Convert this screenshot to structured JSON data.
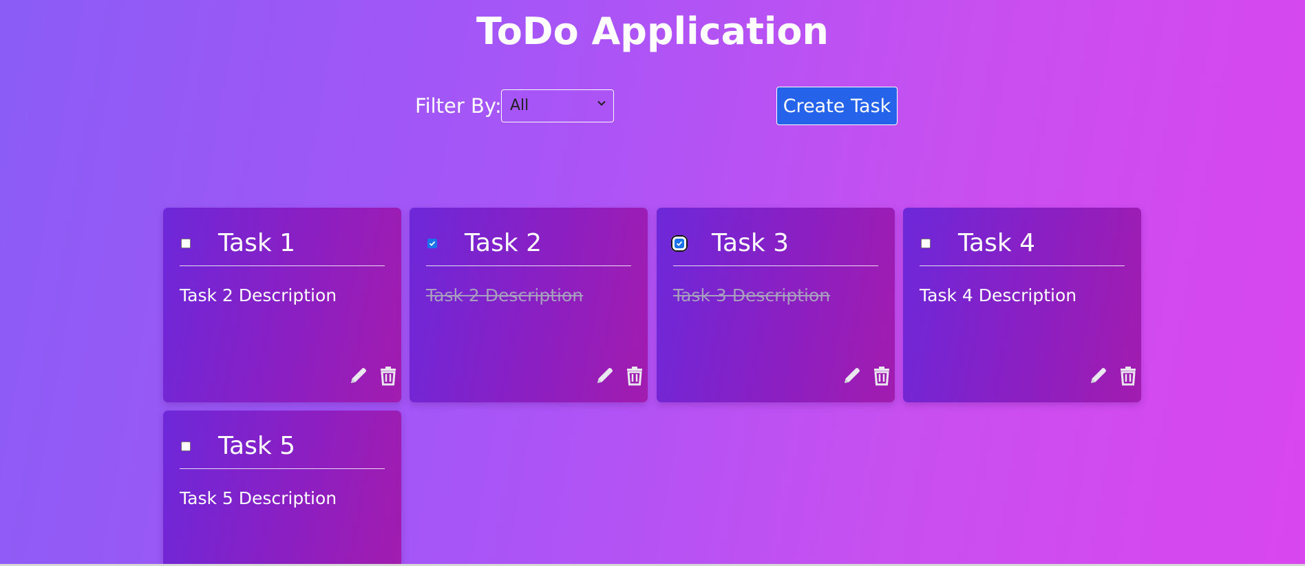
{
  "app": {
    "title": "ToDo Application"
  },
  "toolbar": {
    "filter_label": "Filter By:",
    "filter_value": "All",
    "create_label": "Create Task"
  },
  "tasks": [
    {
      "title": "Task 1",
      "description": "Task 2 Description",
      "completed": false
    },
    {
      "title": "Task 2",
      "description": "Task 2 Description",
      "completed": true
    },
    {
      "title": "Task 3",
      "description": "Task 3 Description",
      "completed": true
    },
    {
      "title": "Task 4",
      "description": "Task 4 Description",
      "completed": false
    },
    {
      "title": "Task 5",
      "description": "Task 5 Description",
      "completed": false
    }
  ],
  "icons": {
    "edit": "pencil-icon",
    "delete": "trash-icon",
    "select": "chevron-down-icon"
  },
  "colors": {
    "create_button": "#2563eb",
    "checkbox_checked": "#1a73e8",
    "card_start": "#6d28d9",
    "card_end": "#a21caf"
  }
}
